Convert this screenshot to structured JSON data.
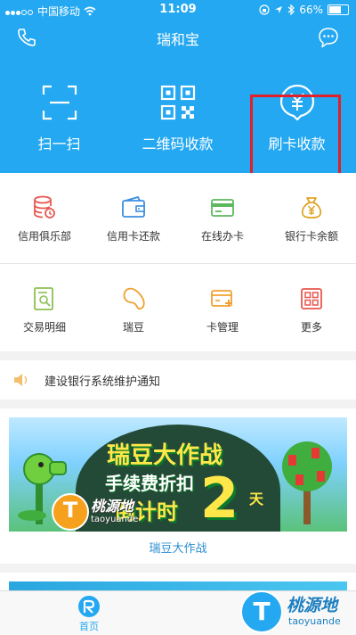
{
  "status_bar": {
    "carrier": "中国移动",
    "time": "11:09",
    "battery": "66%"
  },
  "header": {
    "title": "瑞和宝",
    "quick_actions": [
      {
        "label": "扫一扫",
        "icon": "scan-icon"
      },
      {
        "label": "二维码收款",
        "icon": "qrcode-icon"
      },
      {
        "label": "刷卡收款",
        "icon": "yuan-card-icon"
      }
    ]
  },
  "grid": [
    {
      "label": "信用俱乐部",
      "icon": "database-icon",
      "color": "#e8574f"
    },
    {
      "label": "信用卡还款",
      "icon": "wallet-icon",
      "color": "#3c8ee0"
    },
    {
      "label": "在线办卡",
      "icon": "card-icon",
      "color": "#5bb85d"
    },
    {
      "label": "银行卡余额",
      "icon": "money-bag-icon",
      "color": "#e0a52a"
    },
    {
      "label": "交易明细",
      "icon": "receipt-search-icon",
      "color": "#8cc152"
    },
    {
      "label": "瑞豆",
      "icon": "bean-icon",
      "color": "#f0a030"
    },
    {
      "label": "卡管理",
      "icon": "card-add-icon",
      "color": "#f0a030"
    },
    {
      "label": "更多",
      "icon": "grid-icon",
      "color": "#e8574f"
    }
  ],
  "notice": {
    "text": "建设银行系统维护通知"
  },
  "promo": {
    "banner_line1": "瑞豆大作战",
    "banner_line2": "手续费折扣",
    "banner_line3": "倒计时",
    "banner_number": "2",
    "banner_unit": "天",
    "caption": "瑞豆大作战"
  },
  "watermark": {
    "name": "桃源地",
    "domain": "taoyuande"
  },
  "tabbar": {
    "home_label": "首页"
  },
  "colors": {
    "primary": "#24a8f1",
    "highlight_box": "#e0202a"
  }
}
